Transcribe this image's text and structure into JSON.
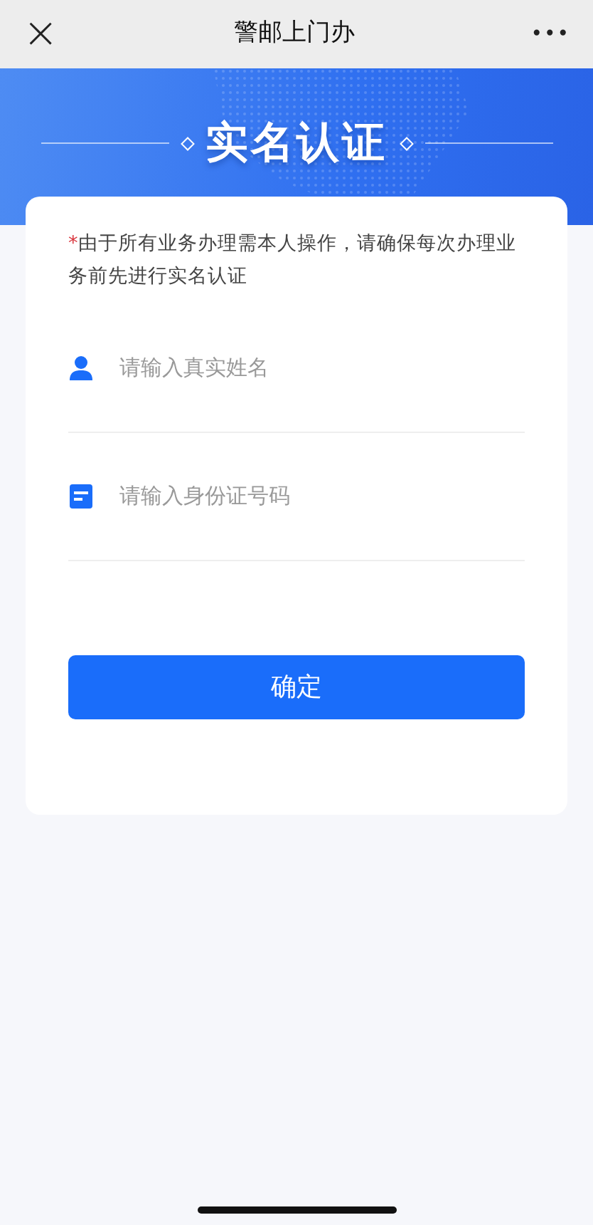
{
  "top_bar": {
    "close": "×",
    "title": "警邮上门办",
    "more": "•••"
  },
  "banner": {
    "title": "实名认证"
  },
  "notice": {
    "required_mark": "*",
    "text": "由于所有业务办理需本人操作，请确保每次办理业务前先进行实名认证"
  },
  "fields": [
    {
      "kind": "person",
      "placeholder": "请输入真实姓名"
    },
    {
      "kind": "id-card",
      "placeholder": "请输入身份证号码"
    }
  ],
  "confirm_button": "确定"
}
